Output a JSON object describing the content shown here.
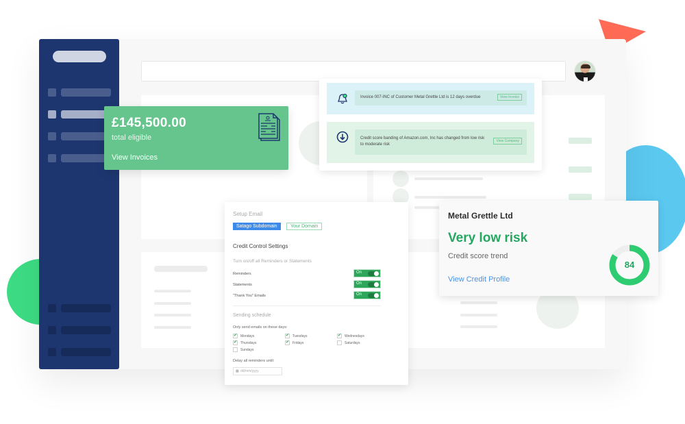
{
  "colors": {
    "sidebar": "#1e3670",
    "accent_green": "#66c48d",
    "risk_green": "#24a861",
    "link_blue": "#4b92e6",
    "tab_blue": "#3d8be8",
    "deco_coral": "#ff6b57",
    "deco_blue": "#5bc8f0",
    "deco_green": "#3ddc84"
  },
  "header": {
    "search_placeholder": "",
    "avatar_icon": "user-avatar"
  },
  "eligible_card": {
    "amount": "£145,500.00",
    "label": "total eligible",
    "link": "View Invoices",
    "icon": "invoice-document-icon"
  },
  "notifications": [
    {
      "icon": "bell-icon",
      "message": "Invoice 007-INC of Customer Metal Grettle Ltd is 12 days overdue",
      "action": "View Invoice"
    },
    {
      "icon": "arrow-down-circle-icon",
      "message": "Credit score banding of Amazon.com, Inc  has changed from low risk to moderate risk",
      "action": "View Company"
    }
  ],
  "settings": {
    "setup_email_heading": "Setup Email",
    "tabs": [
      "Satago Subdomain",
      "Your Domain"
    ],
    "credit_control_heading": "Credit Control Settings",
    "toggle_hint": "Turn on/off all Reminders or Statements",
    "toggles": [
      {
        "label": "Reminders",
        "state": "On"
      },
      {
        "label": "Statements",
        "state": "On"
      },
      {
        "label": "\"Thank You\" Emails",
        "state": "On"
      }
    ],
    "schedule_heading": "Sending schedule",
    "days_label": "Only send emails on these days:",
    "days": [
      {
        "label": "Mondays",
        "checked": true
      },
      {
        "label": "Tuesdays",
        "checked": true
      },
      {
        "label": "Wednesdays",
        "checked": true
      },
      {
        "label": "Thursdays",
        "checked": true
      },
      {
        "label": "Fridays",
        "checked": true
      },
      {
        "label": "Saturdays",
        "checked": false
      },
      {
        "label": "Sundays",
        "checked": false
      }
    ],
    "delay_label": "Delay all reminders until:",
    "date_placeholder": "dd/mm/yyyy"
  },
  "risk_card": {
    "company": "Metal Grettle Ltd",
    "risk_level": "Very low risk",
    "trend_label": "Credit score trend",
    "link": "View Credit Profile",
    "score": "84",
    "score_fraction": 0.84
  }
}
